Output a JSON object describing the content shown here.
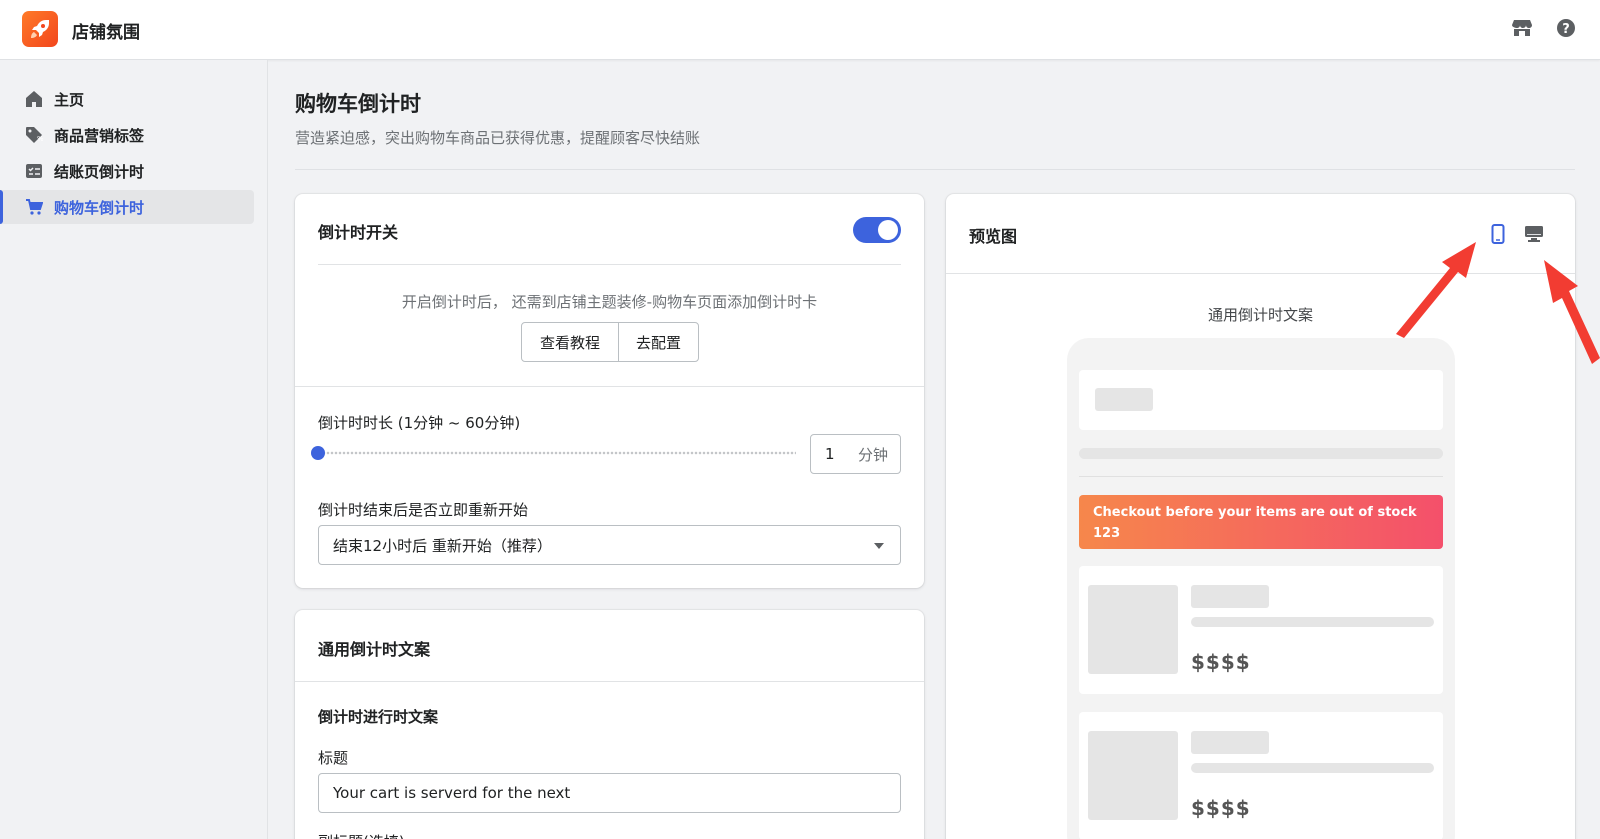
{
  "app": {
    "name": "店铺氛围"
  },
  "sidebar": {
    "items": [
      {
        "label": "主页",
        "icon": "home-icon"
      },
      {
        "label": "商品营销标签",
        "icon": "tag-icon"
      },
      {
        "label": "结账页倒计时",
        "icon": "checklist-icon"
      },
      {
        "label": "购物车倒计时",
        "icon": "cart-icon",
        "active": true
      }
    ]
  },
  "page": {
    "title": "购物车倒计时",
    "subtitle": "营造紧迫感，突出购物车商品已获得优惠，提醒顾客尽快结账"
  },
  "switch_card": {
    "title": "倒计时开关",
    "enabled": true,
    "hint": "开启倒计时后， 还需到店铺主题装修-购物车页面添加倒计时卡",
    "tutorial_btn": "查看教程",
    "config_btn": "去配置",
    "duration_label": "倒计时时长 (1分钟 ~ 60分钟)",
    "duration_value": "1",
    "duration_unit": "分钟",
    "duration_fraction": 0,
    "restart_label": "倒计时结束后是否立即重新开始",
    "restart_value": "结束12小时后 重新开始（推荐）"
  },
  "copy_card": {
    "title": "通用倒计时文案",
    "section_label": "倒计时进行时文案",
    "title_label": "标题",
    "title_value": "Your cart is serverd for the next",
    "subtitle_label": "副标题(选填)"
  },
  "preview": {
    "title": "预览图",
    "caption": "通用倒计时文案",
    "banner_line1": "Checkout before your items are out of stock",
    "banner_line2": "123",
    "price1": "$$$$",
    "price2": "$$$$",
    "accent_color": "#3d63dd",
    "arrow_color": "#f23c32"
  }
}
